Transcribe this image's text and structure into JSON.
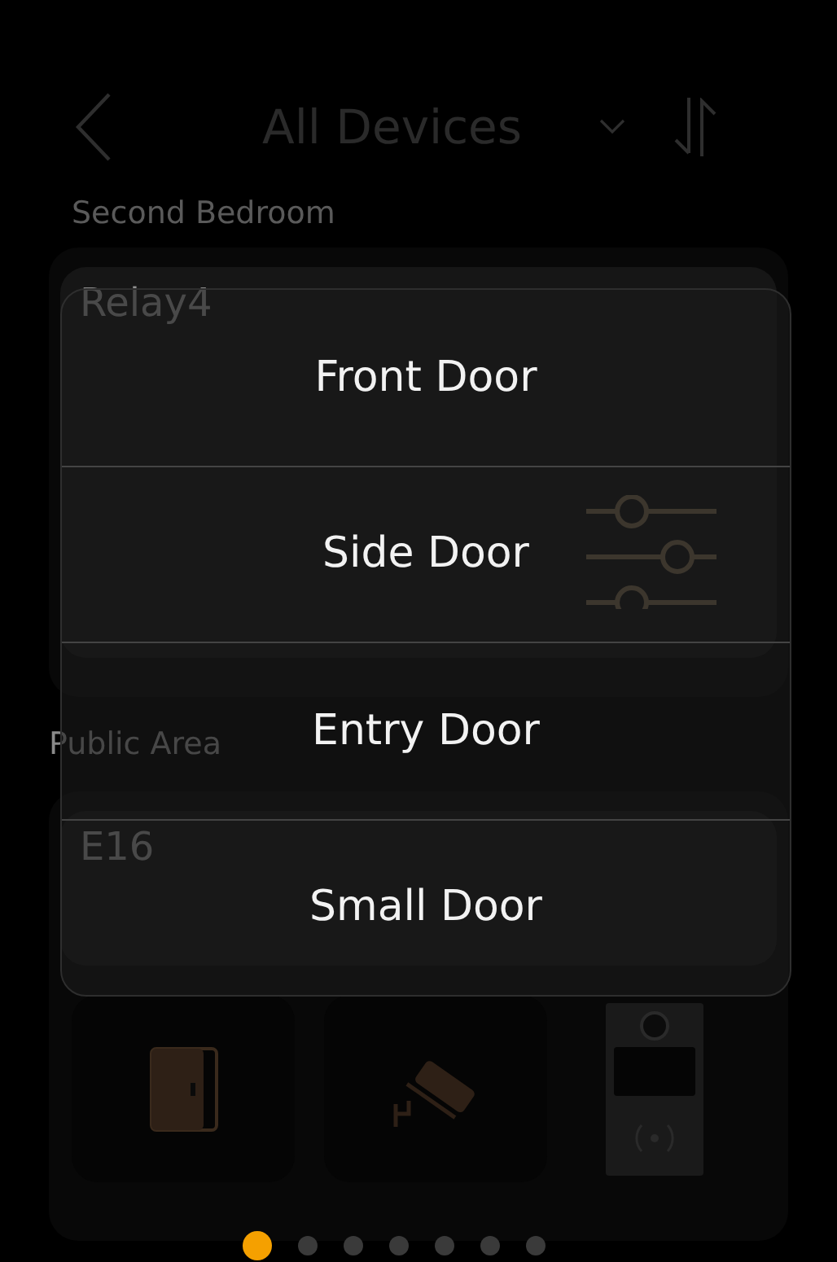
{
  "header": {
    "title": "All Devices"
  },
  "sections": [
    {
      "title": "Second Bedroom",
      "card": {
        "name": "Relay4"
      }
    },
    {
      "title": "Public Area",
      "card": {
        "name": "E16",
        "devices": [
          {
            "kind": "door"
          },
          {
            "kind": "camera"
          },
          {
            "kind": "intercom"
          }
        ]
      }
    }
  ],
  "dropdown": {
    "options": [
      {
        "label": "Front Door"
      },
      {
        "label": "Side Door"
      },
      {
        "label": "Entry Door"
      },
      {
        "label": "Small Door"
      }
    ]
  },
  "pages": [
    {
      "selected": true
    },
    {
      "selected": false
    },
    {
      "selected": false
    },
    {
      "selected": false
    },
    {
      "selected": false
    },
    {
      "selected": false
    },
    {
      "selected": false
    }
  ]
}
